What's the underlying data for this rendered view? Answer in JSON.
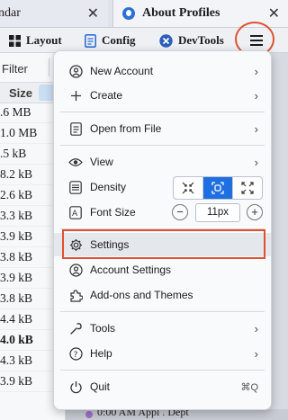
{
  "tabs": {
    "left_label": "ndar",
    "right_label": "About Profiles",
    "close_glyph": "✕"
  },
  "toolbar": {
    "layout": "Layout",
    "config": "Config",
    "devtools": "DevTools"
  },
  "left_panel": {
    "filter_label": "Filter",
    "column_header": "Size",
    "rows": [
      {
        "text": ".6 MB",
        "bold": false
      },
      {
        "text": "1.0 MB",
        "bold": false
      },
      {
        "text": ".5 kB",
        "bold": false
      },
      {
        "text": "8.2 kB",
        "bold": false
      },
      {
        "text": "2.6 kB",
        "bold": false
      },
      {
        "text": "3.3 kB",
        "bold": false
      },
      {
        "text": "3.9 kB",
        "bold": false
      },
      {
        "text": "3.8 kB",
        "bold": false
      },
      {
        "text": "3.9 kB",
        "bold": false
      },
      {
        "text": "3.8 kB",
        "bold": false
      },
      {
        "text": "4.4 kB",
        "bold": false
      },
      {
        "text": "4.0 kB",
        "bold": true
      },
      {
        "text": "4.3 kB",
        "bold": false
      },
      {
        "text": "3.9 kB",
        "bold": false
      }
    ]
  },
  "bottom_strip": {
    "text": "0:00 AM  Appl . Dept"
  },
  "menu": {
    "new_account": "New Account",
    "create": "Create",
    "open_from_file": "Open from File",
    "view": "View",
    "density": "Density",
    "font_size": "Font Size",
    "font_size_value": "11px",
    "settings": "Settings",
    "account_settings": "Account Settings",
    "addons": "Add-ons and Themes",
    "tools": "Tools",
    "help": "Help",
    "quit": "Quit",
    "quit_shortcut": "⌘Q",
    "chevron": "›",
    "minus": "−",
    "plus": "+"
  },
  "colors": {
    "highlight": "#e0512f",
    "accent": "#1f6fe0"
  }
}
